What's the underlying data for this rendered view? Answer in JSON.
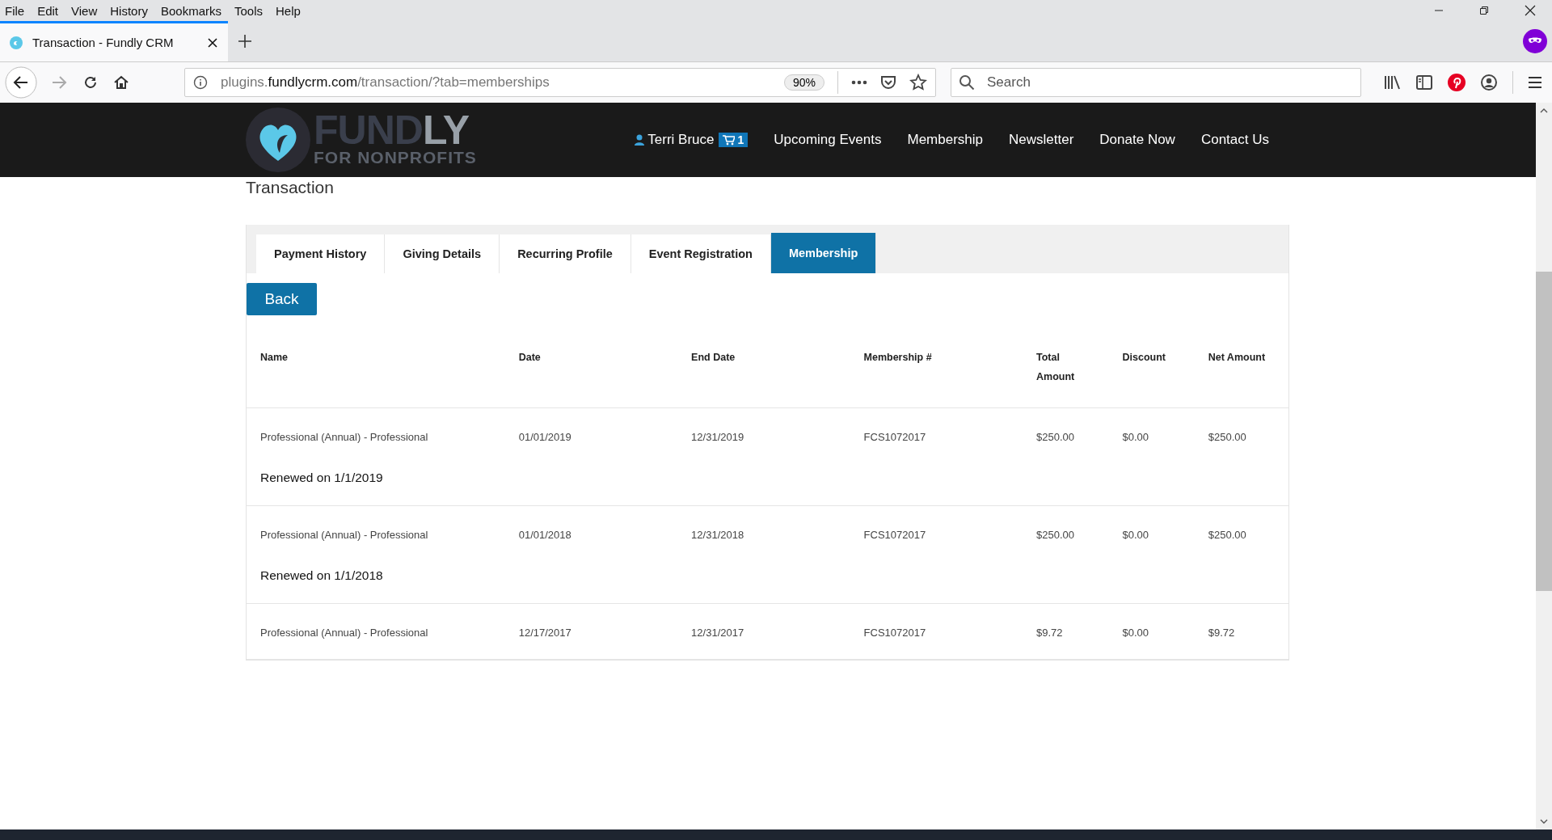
{
  "browser": {
    "menu": [
      "File",
      "Edit",
      "View",
      "History",
      "Bookmarks",
      "Tools",
      "Help"
    ],
    "tab": {
      "title": "Transaction - Fundly CRM"
    },
    "url": {
      "prefix": "plugins.",
      "domain": "fundlycrm.com",
      "path": "/transaction/?tab=memberships"
    },
    "zoom": "90%",
    "search": {
      "placeholder": "Search"
    }
  },
  "site": {
    "logo": {
      "word_a": "FUND",
      "word_b": "LY",
      "tagline": "FOR NONPROFITS"
    },
    "user": "Terri Bruce",
    "cart_count": "1",
    "nav": [
      "Upcoming Events",
      "Membership",
      "Newsletter",
      "Donate Now",
      "Contact Us"
    ]
  },
  "page_title": "Transaction",
  "tabs": [
    {
      "label": "Payment History",
      "selected": false
    },
    {
      "label": "Giving Details",
      "selected": false
    },
    {
      "label": "Recurring Profile",
      "selected": false
    },
    {
      "label": "Event Registration",
      "selected": false
    },
    {
      "label": "Membership",
      "selected": true
    }
  ],
  "back_button": "Back",
  "table": {
    "columns": [
      "Name",
      "Date",
      "End Date",
      "Membership #",
      "Total Amount",
      "Discount",
      "Net Amount"
    ],
    "rows": [
      {
        "cells": [
          "Professional (Annual) - Professional",
          "01/01/2019",
          "12/31/2019",
          "FCS1072017",
          "$250.00",
          "$0.00",
          "$250.00"
        ],
        "note": "Renewed on 1/1/2019"
      },
      {
        "cells": [
          "Professional (Annual) - Professional",
          "01/01/2018",
          "12/31/2018",
          "FCS1072017",
          "$250.00",
          "$0.00",
          "$250.00"
        ],
        "note": "Renewed on 1/1/2018"
      },
      {
        "cells": [
          "Professional (Annual) - Professional",
          "12/17/2017",
          "12/31/2017",
          "FCS1072017",
          "$9.72",
          "$0.00",
          "$9.72"
        ]
      }
    ]
  }
}
